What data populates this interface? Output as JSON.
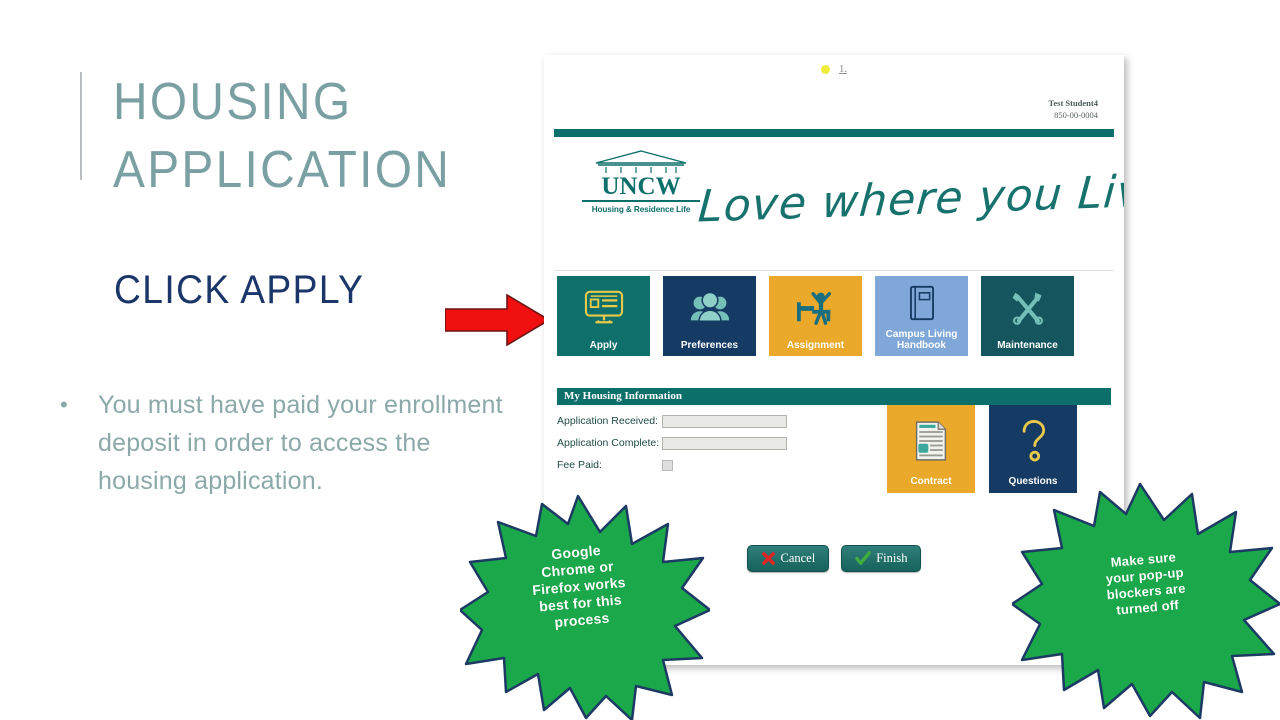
{
  "slide": {
    "title": "HOUSING\nAPPLICATION",
    "subtitle": "CLICK APPLY",
    "bullet_marker": "•",
    "bullet": "You must have paid your enrollment deposit in order to access the housing application.",
    "title_color": "#7ba0a3",
    "subtitle_color": "#1b3668",
    "body_color": "#8aa9a8",
    "arrow_color": "#f01010"
  },
  "browser": {
    "loading_label": "1.",
    "loading_dot_color": "#eded3a"
  },
  "portal": {
    "student_name": "Test Student4",
    "student_id": "850-00-0004",
    "logo": {
      "name": "UNCW",
      "subtitle": "Housing & Residence Life"
    },
    "tagline": "Love where you Live!",
    "brand_teal": "#0d6f6a",
    "tiles": [
      {
        "label": "Apply",
        "icon": "monitor-form-icon",
        "bg": "#0f706b",
        "icon_color": "#e8c94a"
      },
      {
        "label": "Preferences",
        "icon": "people-group-icon",
        "bg": "#153a63",
        "icon_color": "#74bfb8"
      },
      {
        "label": "Assignment",
        "icon": "person-bed-icon",
        "bg": "#eaa92b",
        "icon_color": "#1a6f7e"
      },
      {
        "label": "Campus Living Handbook",
        "icon": "book-icon",
        "bg": "#7fa8d9",
        "icon_color": "#153a63"
      },
      {
        "label": "Maintenance",
        "icon": "tools-icon",
        "bg": "#15565e",
        "icon_color": "#74bfb8"
      }
    ],
    "housing_section": {
      "header": "My Housing Information",
      "fields": [
        {
          "label": "Application Received:",
          "value": "",
          "type": "text"
        },
        {
          "label": "Application Complete:",
          "value": "",
          "type": "text"
        },
        {
          "label": "Fee Paid:",
          "value": "",
          "type": "checkbox"
        }
      ]
    },
    "side_tiles": [
      {
        "label": "Contract",
        "icon": "document-icon",
        "bg": "#eaa92b",
        "icon_color": "#ffffff"
      },
      {
        "label": "Questions",
        "icon": "question-mark-icon",
        "bg": "#153a63",
        "icon_color": "#e8c94a"
      }
    ],
    "buttons": [
      {
        "label": "Cancel",
        "icon": "x-mark-icon",
        "icon_color": "#e02424"
      },
      {
        "label": "Finish",
        "icon": "check-mark-icon",
        "icon_color": "#3fae3f"
      }
    ]
  },
  "callouts": [
    {
      "text": "Google\nChrome or\nFirefox works\nbest for this\nprocess",
      "color": "#1aa84a"
    },
    {
      "text": "Make sure\nyour pop-up\nblockers are\nturned off",
      "color": "#1aa84a"
    }
  ]
}
